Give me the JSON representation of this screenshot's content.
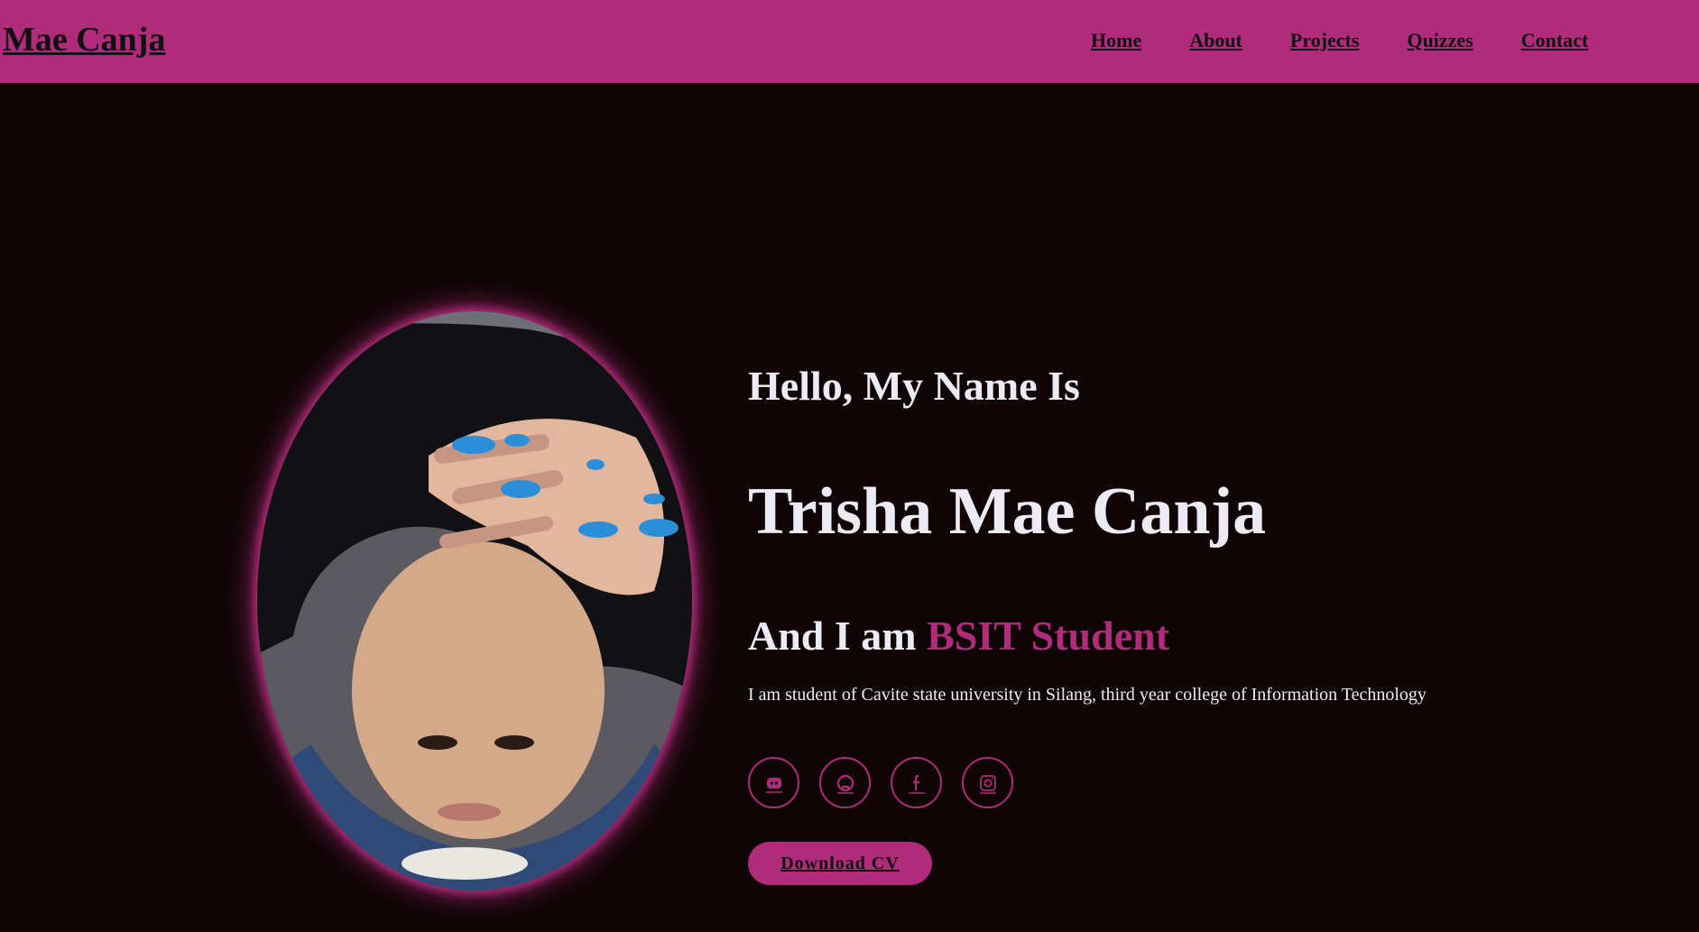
{
  "header": {
    "logo": "Mae Canja",
    "nav": [
      "Home",
      "About",
      "Projects",
      "Quizzes",
      "Contact"
    ],
    "background": "#b02b79"
  },
  "hero": {
    "greeting": "Hello, My Name Is",
    "name": "Trisha Mae Canja",
    "role_prefix": "And I am ",
    "role_highlight": "BSIT Student",
    "bio": "I am student of Cavite state university in Silang, third year college of Information Technology",
    "socials": [
      {
        "icon": "discord-icon"
      },
      {
        "icon": "github-icon"
      },
      {
        "icon": "facebook-icon"
      },
      {
        "icon": "instagram-icon"
      }
    ],
    "cv_button": "Download CV",
    "accent_color": "#b02b79",
    "background": "#0f0506"
  }
}
